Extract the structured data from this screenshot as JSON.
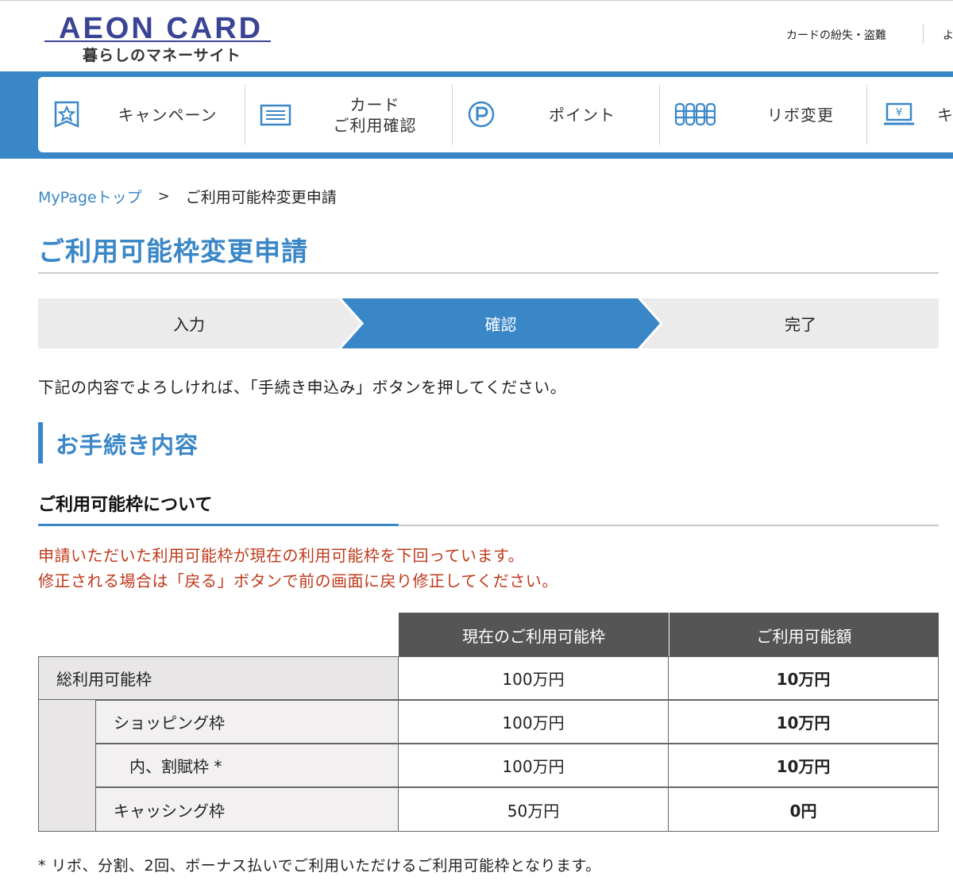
{
  "header": {
    "logo_main": "AEON CARD",
    "logo_sub": "暮らしのマネーサイト",
    "util_links": [
      "カードの紛失・盗難",
      "よ"
    ]
  },
  "nav": {
    "items": [
      {
        "label": "キャンペーン",
        "icon": "star-badge-icon"
      },
      {
        "label": "カード\nご利用確認",
        "icon": "card-statement-icon"
      },
      {
        "label": "ポイント",
        "icon": "point-p-icon"
      },
      {
        "label": "リボ変更",
        "icon": "coin-stack-icon"
      },
      {
        "label": "キ",
        "icon": "yen-laptop-icon"
      }
    ]
  },
  "breadcrumb": {
    "home": "MyPageトップ",
    "separator": ">",
    "current": "ご利用可能枠変更申請"
  },
  "page_title": "ご利用可能枠変更申請",
  "steps": [
    {
      "label": "入力",
      "active": false
    },
    {
      "label": "確認",
      "active": true
    },
    {
      "label": "完了",
      "active": false
    }
  ],
  "instruction": "下記の内容でよろしければ、「手続き申込み」ボタンを押してください。",
  "section_title": "お手続き内容",
  "sub_title": "ご利用可能枠について",
  "warning": {
    "line1": "申請いただいた利用可能枠が現在の利用可能枠を下回っています。",
    "line2": "修正される場合は「戻る」ボタンで前の画面に戻り修正してください。"
  },
  "table": {
    "headers": [
      "現在のご利用可能枠",
      "ご利用可能額"
    ],
    "rows": [
      {
        "label": "総利用可能枠",
        "current": "100万円",
        "available": "10万円"
      },
      {
        "label": "ショッピング枠",
        "current": "100万円",
        "available": "10万円"
      },
      {
        "label": "内、割賦枠 *",
        "current": "100万円",
        "available": "10万円"
      },
      {
        "label": "キャッシング枠",
        "current": "50万円",
        "available": "0円"
      }
    ]
  },
  "footnote": "* リボ、分割、2回、ボーナス払いでご利用いただけるご利用可能枠となります。",
  "colors": {
    "brand_blue": "#3a87c8",
    "logo_navy": "#3a4494",
    "warning_red": "#c0391b",
    "header_dark": "#555555"
  }
}
